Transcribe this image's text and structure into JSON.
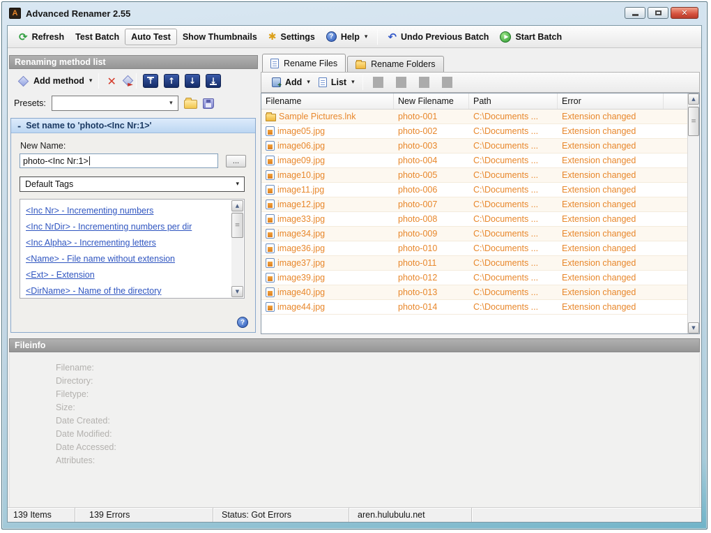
{
  "window": {
    "title": "Advanced Renamer 2.55",
    "icon_letter": "A"
  },
  "toolbar": {
    "refresh": "Refresh",
    "test_batch": "Test Batch",
    "auto_test": "Auto Test",
    "show_thumbnails": "Show Thumbnails",
    "settings": "Settings",
    "help": "Help",
    "undo_previous_batch": "Undo Previous Batch",
    "start_batch": "Start Batch"
  },
  "method_panel": {
    "header": "Renaming method list",
    "add_method_label": "Add method",
    "presets_label": "Presets:",
    "presets_value": "",
    "method_title": "Set name to 'photo-<Inc Nr:1>'",
    "new_name_label": "New Name:",
    "new_name_value": "photo-<Inc Nr:1>",
    "browse_label": "...",
    "tags_dropdown_value": "Default Tags",
    "tags": [
      "<Inc Nr> - Incrementing numbers",
      "<Inc NrDir> - Incrementing numbers per dir",
      "<Inc Alpha> - Incrementing letters",
      "<Name> - File name without extension",
      "<Ext> - Extension",
      "<DirName> - Name of the directory"
    ]
  },
  "files_panel": {
    "tabs": [
      "Rename Files",
      "Rename Folders"
    ],
    "add_label": "Add",
    "list_label": "List",
    "columns": [
      "Filename",
      "New Filename",
      "Path",
      "Error"
    ],
    "rows": [
      {
        "icon": "folder",
        "filename": "Sample Pictures.lnk",
        "new_filename": "photo-001",
        "path": "C:\\Documents ...",
        "error": "Extension changed"
      },
      {
        "icon": "image",
        "filename": "image05.jpg",
        "new_filename": "photo-002",
        "path": "C:\\Documents ...",
        "error": "Extension changed"
      },
      {
        "icon": "image",
        "filename": "image06.jpg",
        "new_filename": "photo-003",
        "path": "C:\\Documents ...",
        "error": "Extension changed"
      },
      {
        "icon": "image",
        "filename": "image09.jpg",
        "new_filename": "photo-004",
        "path": "C:\\Documents ...",
        "error": "Extension changed"
      },
      {
        "icon": "image",
        "filename": "image10.jpg",
        "new_filename": "photo-005",
        "path": "C:\\Documents ...",
        "error": "Extension changed"
      },
      {
        "icon": "image",
        "filename": "image11.jpg",
        "new_filename": "photo-006",
        "path": "C:\\Documents ...",
        "error": "Extension changed"
      },
      {
        "icon": "image",
        "filename": "image12.jpg",
        "new_filename": "photo-007",
        "path": "C:\\Documents ...",
        "error": "Extension changed"
      },
      {
        "icon": "image",
        "filename": "image33.jpg",
        "new_filename": "photo-008",
        "path": "C:\\Documents ...",
        "error": "Extension changed"
      },
      {
        "icon": "image",
        "filename": "image34.jpg",
        "new_filename": "photo-009",
        "path": "C:\\Documents ...",
        "error": "Extension changed"
      },
      {
        "icon": "image",
        "filename": "image36.jpg",
        "new_filename": "photo-010",
        "path": "C:\\Documents ...",
        "error": "Extension changed"
      },
      {
        "icon": "image",
        "filename": "image37.jpg",
        "new_filename": "photo-011",
        "path": "C:\\Documents ...",
        "error": "Extension changed"
      },
      {
        "icon": "image",
        "filename": "image39.jpg",
        "new_filename": "photo-012",
        "path": "C:\\Documents ...",
        "error": "Extension changed"
      },
      {
        "icon": "image",
        "filename": "image40.jpg",
        "new_filename": "photo-013",
        "path": "C:\\Documents ...",
        "error": "Extension changed"
      },
      {
        "icon": "image",
        "filename": "image44.jpg",
        "new_filename": "photo-014",
        "path": "C:\\Documents ...",
        "error": "Extension changed"
      }
    ]
  },
  "fileinfo": {
    "header": "Fileinfo",
    "labels": [
      "Filename:",
      "Directory:",
      "Filetype:",
      "Size:",
      "Date Created:",
      "Date Modified:",
      "Date Accessed:",
      "Attributes:"
    ]
  },
  "statusbar": {
    "items": "139 Items",
    "errors": "139 Errors",
    "status": "Status: Got Errors",
    "site": "aren.hulubulu.net"
  },
  "icons": {
    "refresh": "⟳",
    "settings": "✱",
    "help": "?",
    "undo": "↶",
    "play": "▶",
    "dropdown": "▾",
    "delete": "✕",
    "close": "✕",
    "question": "?",
    "collapse": "-",
    "arrow_up": "↑",
    "arrow_down": "↓",
    "scroll_up": "▲",
    "scroll_down": "▼",
    "grip": "≡",
    "red_arrow": "►"
  },
  "colors": {
    "error_text": "#e8872b",
    "link": "#2f55c0",
    "navy_button": "#1d3f8e",
    "method_header_text": "#1c3a63"
  }
}
